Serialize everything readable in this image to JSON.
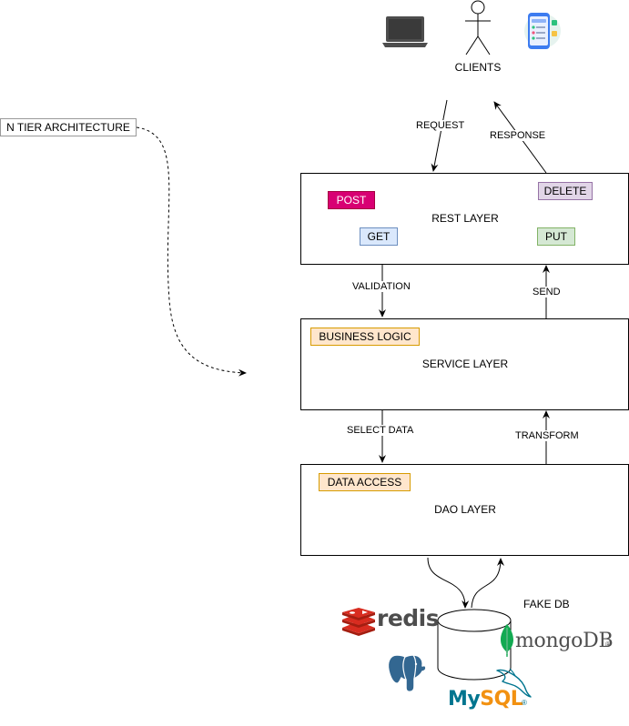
{
  "title": "N TIER ARCHITECTURE",
  "clients": {
    "label": "CLIENTS"
  },
  "edges": {
    "request": "REQUEST",
    "response": "RESPONSE",
    "validation": "VALIDATION",
    "send": "SEND",
    "select_data": "SELECT DATA",
    "transform": "TRANSFORM"
  },
  "layers": {
    "rest": {
      "label": "REST LAYER",
      "tags": {
        "post": "POST",
        "delete": "DELETE",
        "get": "GET",
        "put": "PUT"
      }
    },
    "service": {
      "label": "SERVICE LAYER",
      "tag": "BUSINESS LOGIC"
    },
    "dao": {
      "label": "DAO LAYER",
      "tag": "DATA ACCESS"
    }
  },
  "database": {
    "label": "FAKE DB",
    "logos": {
      "redis": "redis",
      "mongodb": "mongoDB",
      "mongodb_mark": "®",
      "mysql": "MySQL",
      "mysql_mark": "®"
    }
  },
  "colors": {
    "post_fill": "#d80073",
    "delete_fill": "#e1d5e7",
    "delete_border": "#9673a6",
    "get_fill": "#dae8fc",
    "get_border": "#6c8ebf",
    "put_fill": "#d5e8d4",
    "put_border": "#82b366",
    "orange_fill": "#ffe6cc",
    "orange_border": "#d79b00",
    "redis_red": "#d82c20",
    "mongo_green": "#13aa52",
    "mysql_blue": "#00758f",
    "mysql_orange": "#f29111",
    "postgres_blue": "#336791"
  },
  "icons": [
    "laptop-icon",
    "stick-figure-user-icon",
    "mobile-app-icon",
    "redis-logo",
    "mongodb-logo",
    "postgresql-logo",
    "mysql-logo",
    "database-cylinder-icon"
  ]
}
